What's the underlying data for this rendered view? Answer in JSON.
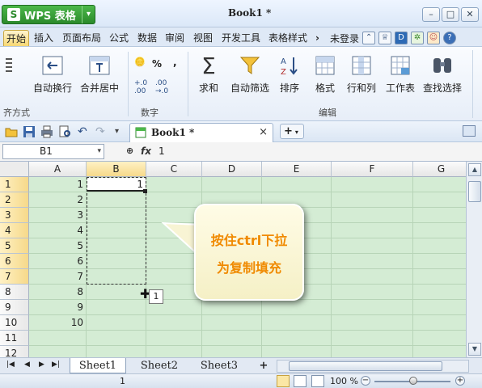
{
  "app": {
    "logo": "S",
    "name": "WPS 表格",
    "document_title": "Book1 *"
  },
  "window_controls": {
    "minimize": "–",
    "restore": "□",
    "close": "✕"
  },
  "menu": {
    "tabs": [
      "开始",
      "插入",
      "页面布局",
      "公式",
      "数据",
      "审阅",
      "视图",
      "开发工具",
      "表格样式"
    ],
    "active_tab": "开始",
    "login": "未登录",
    "more": "›"
  },
  "ribbon": {
    "left_group_label": "齐方式",
    "number_group_label": "数字",
    "edit_group_label": "编辑",
    "buttons": {
      "wrap": "自动换行",
      "merge": "合并居中",
      "sum": "求和",
      "filter": "自动筛选",
      "sort": "排序",
      "format": "格式",
      "rows_cols": "行和列",
      "worksheet": "工作表",
      "find": "查找选择"
    },
    "number_symbols": {
      "percent": "%",
      "comma": ","
    }
  },
  "doc_tab": {
    "title": "Book1 *",
    "close": "×",
    "new": "+"
  },
  "formula_bar": {
    "name_box": "B1",
    "fx": "fx",
    "value": "1"
  },
  "columns": [
    "A",
    "B",
    "C",
    "D",
    "E",
    "F",
    "G"
  ],
  "selected_column": "B",
  "rows": [
    "1",
    "2",
    "3",
    "4",
    "5",
    "6",
    "7",
    "8",
    "9",
    "10",
    "11",
    "12"
  ],
  "selected_rows": [
    "1",
    "2",
    "3",
    "4",
    "5",
    "6",
    "7"
  ],
  "column_a_values": [
    "1",
    "2",
    "3",
    "4",
    "5",
    "6",
    "7",
    "8",
    "9",
    "10"
  ],
  "cell_b1": "1",
  "fill_tooltip": "1",
  "callout": {
    "line1": "按住ctrl下拉",
    "line2": "为复制填充"
  },
  "sheets": {
    "tabs": [
      "Sheet1",
      "Sheet2",
      "Sheet3"
    ],
    "active": "Sheet1",
    "add": "+"
  },
  "statusbar": {
    "count": "1",
    "zoom": "100 %",
    "zoom_minus": "−",
    "zoom_plus": "+"
  }
}
